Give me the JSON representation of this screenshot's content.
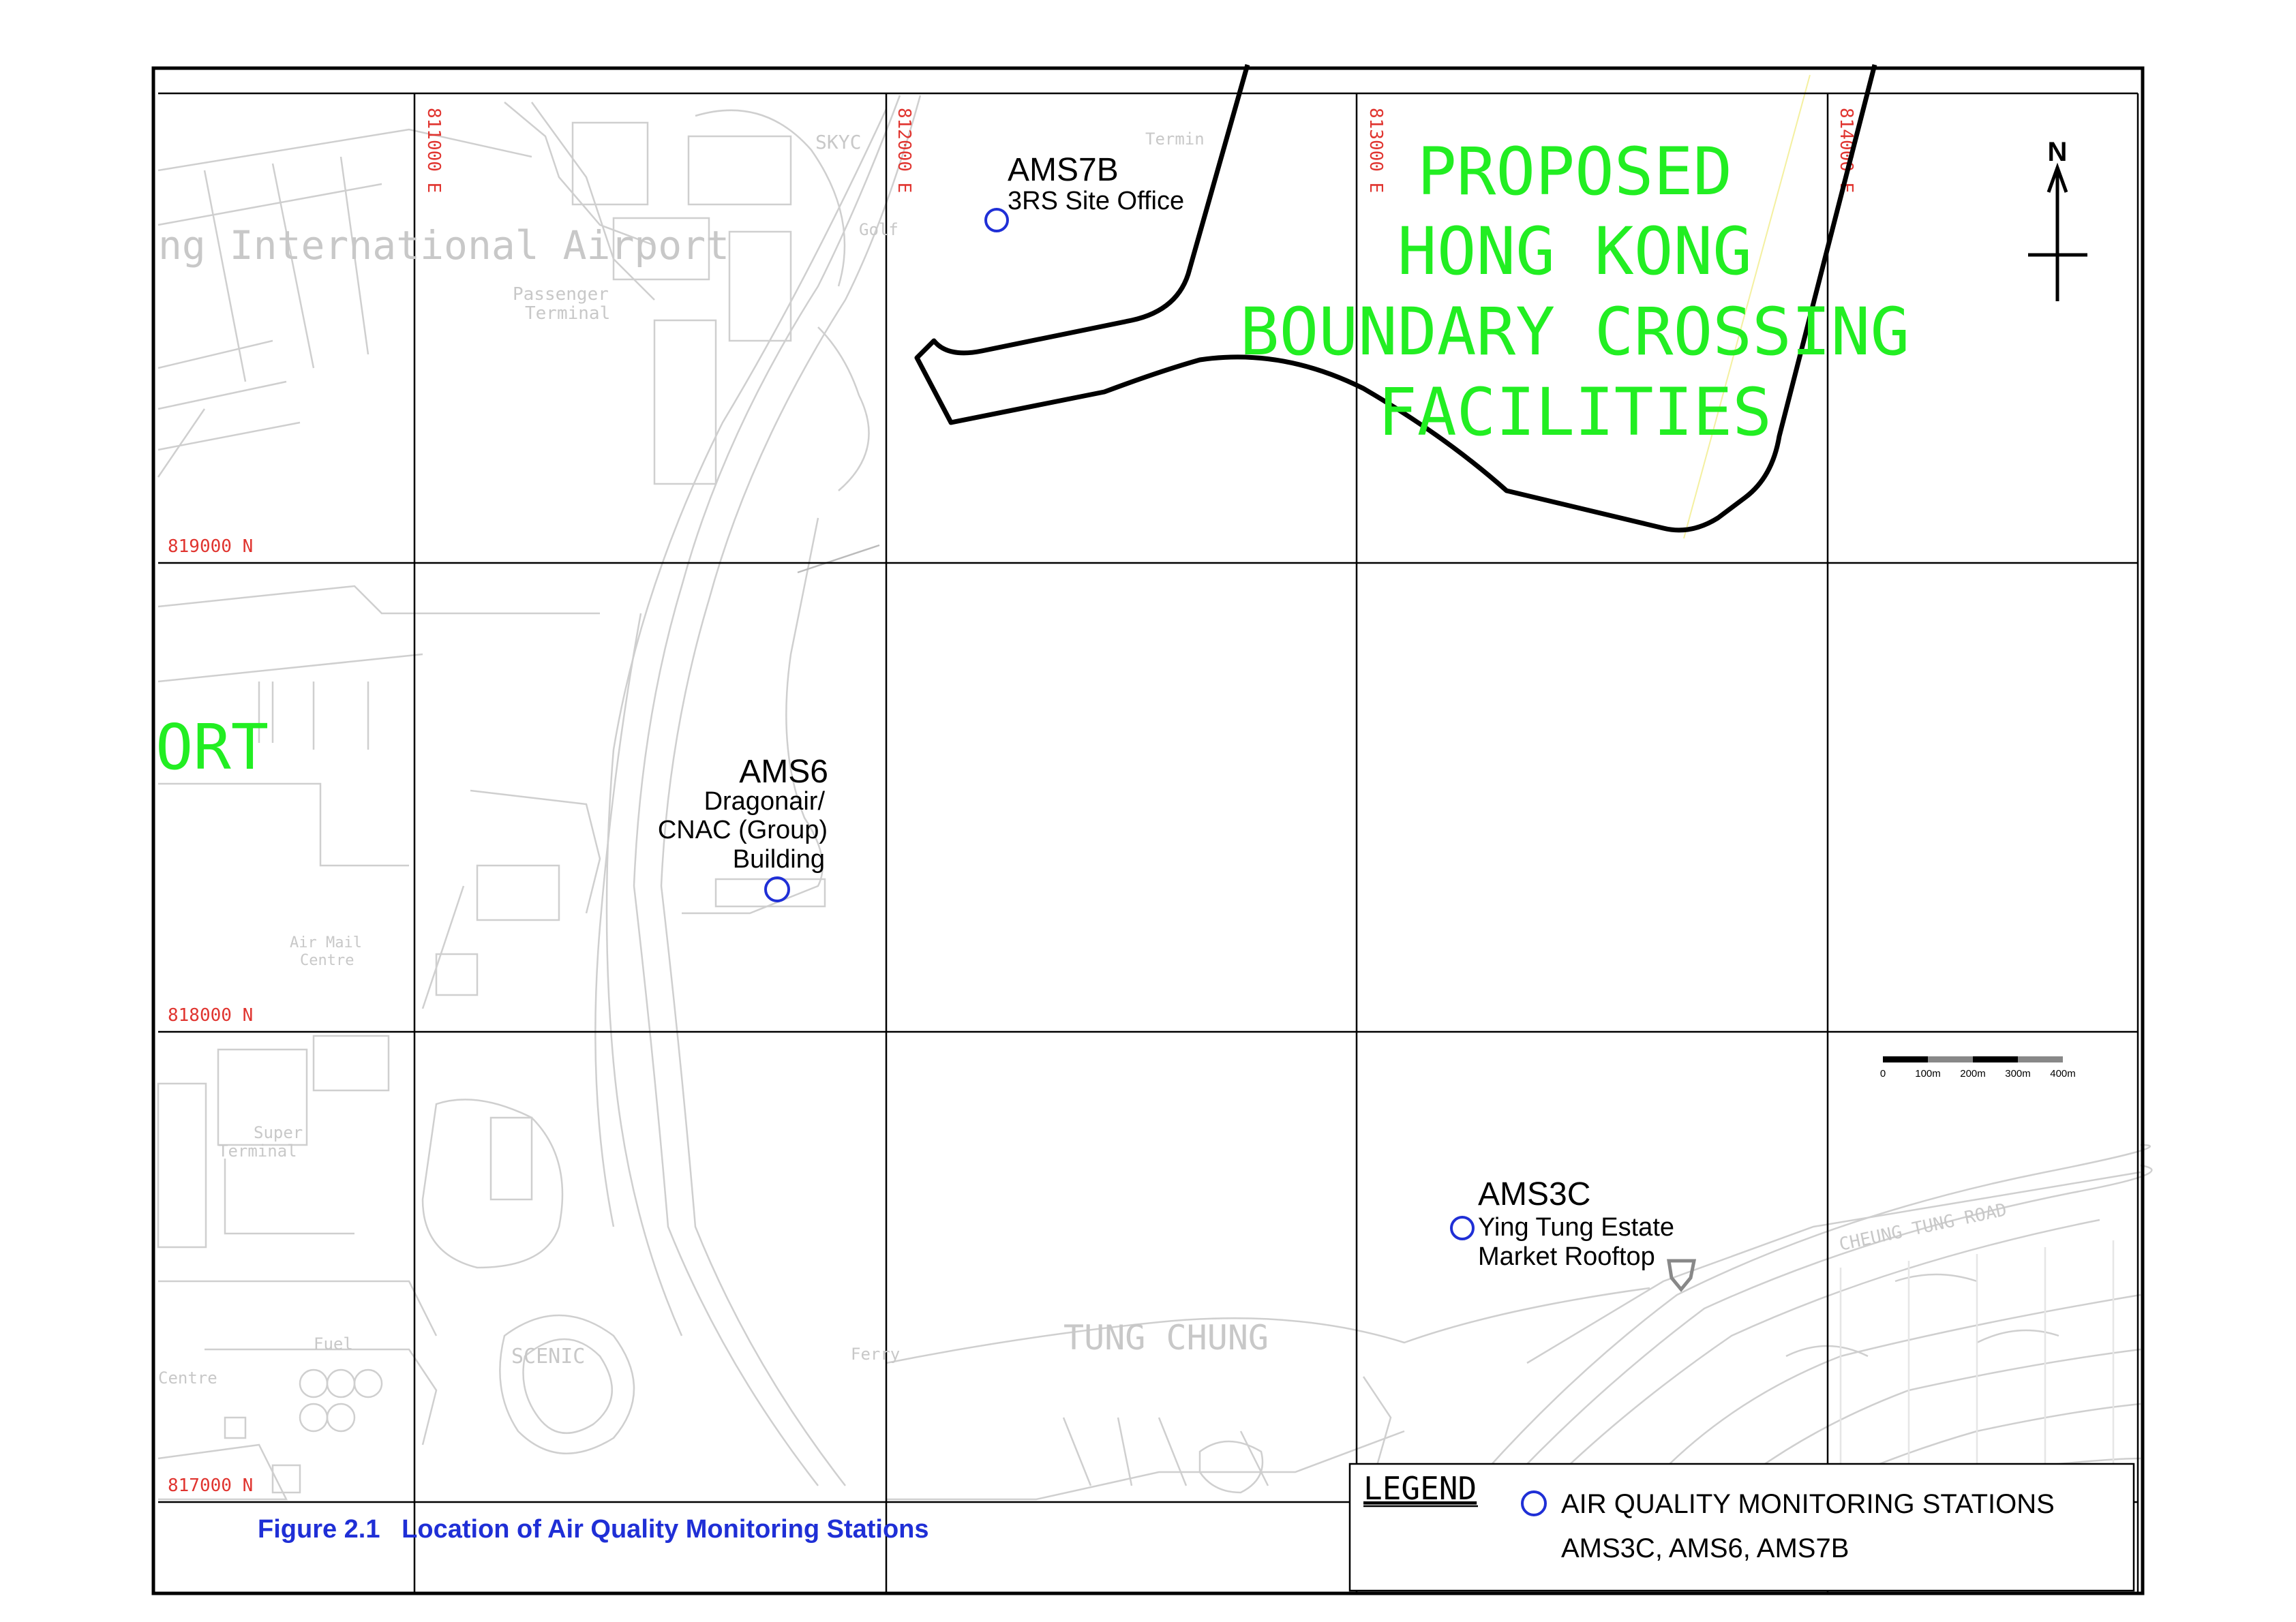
{
  "map": {
    "grid_eastings": [
      "811000 E",
      "812000 E",
      "813000 E",
      "814000 E"
    ],
    "grid_northings": [
      "819000 N",
      "818000 N",
      "817000 N"
    ],
    "base_labels": {
      "airport_name": "ng International Airport",
      "passenger_terminal": "Passenger",
      "passenger_terminal_2": "Terminal",
      "skycity": "SKYC",
      "golf": "Golf",
      "terminal_top": "Termin",
      "air_mail_centre": "Air Mail",
      "air_mail_centre_2": "Centre",
      "super_terminal": "Super",
      "super_terminal_2": "Terminal",
      "fuel": "Fuel",
      "centre_left": "Centre",
      "scenic": "SCENIC",
      "ferry": "Ferry",
      "tung_chung": "TUNG CHUNG",
      "cheung_tung_road": "CHEUNG TUNG ROAD",
      "port_fragment": "ORT"
    },
    "site_label_lines": [
      "PROPOSED",
      "HONG KONG",
      "BOUNDARY CROSSING",
      "FACILITIES"
    ],
    "north_label": "N",
    "scale_labels": [
      "0",
      "100m",
      "200m",
      "300m",
      "400m"
    ],
    "stations": [
      {
        "id": "AMS7B",
        "desc": [
          "3RS Site Office"
        ]
      },
      {
        "id": "AMS6",
        "desc": [
          "Dragonair/",
          "CNAC (Group)",
          "Building"
        ]
      },
      {
        "id": "AMS3C",
        "desc": [
          "Ying Tung Estate",
          "Market Rooftop"
        ]
      }
    ],
    "caption": "Figure 2.1   Location of Air Quality Monitoring Stations",
    "legend": {
      "title": "LEGEND",
      "item_label": "AIR QUALITY MONITORING STATIONS",
      "item_stations": "AMS3C, AMS6, AMS7B"
    },
    "colors": {
      "grid_label": "#e0342f",
      "site_label": "#22ee22",
      "station_marker": "#1f2fd6",
      "caption": "#1f2fd6",
      "boundary": "#000000",
      "basemap": "#c8c8c8"
    }
  }
}
